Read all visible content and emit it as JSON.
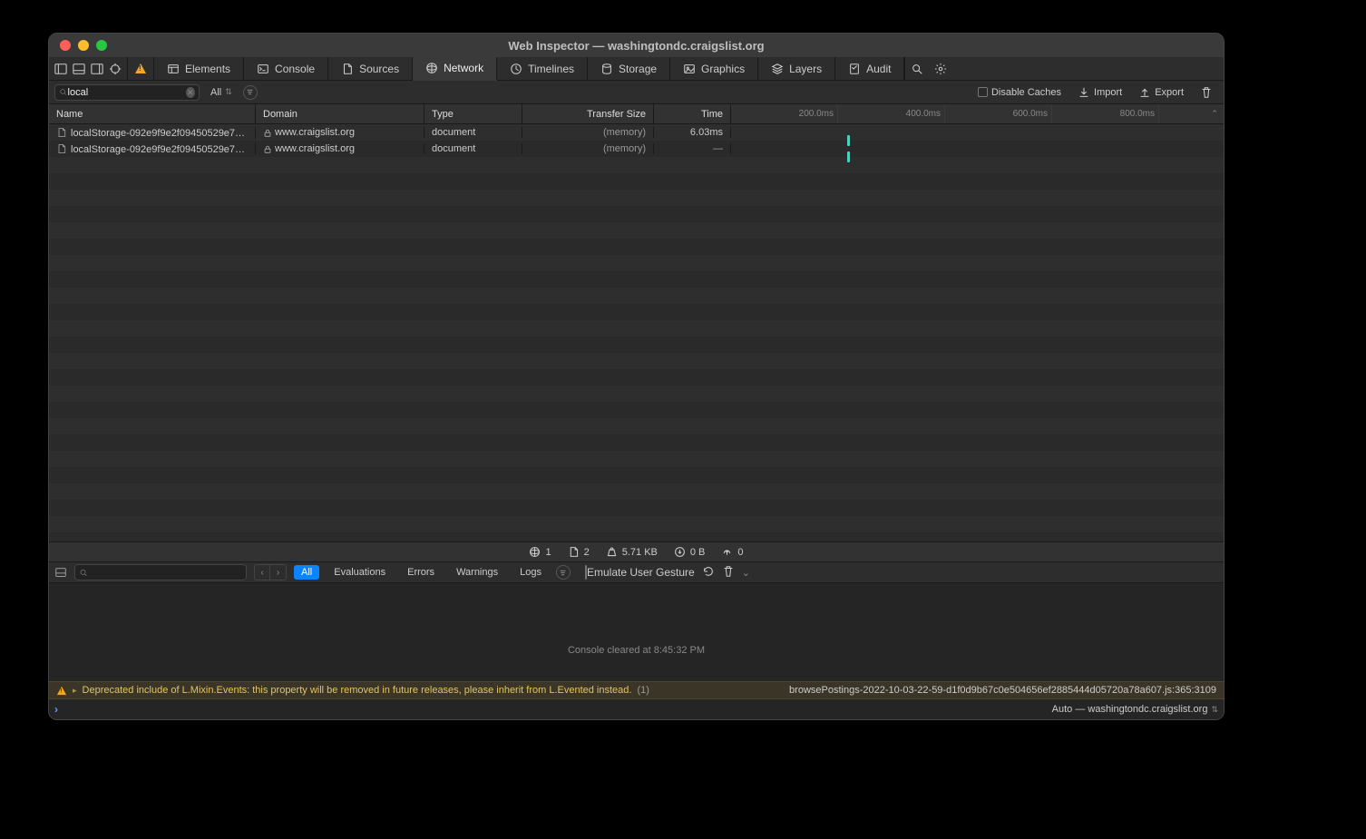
{
  "title": "Web Inspector — washingtondc.craigslist.org",
  "tabs": {
    "elements": "Elements",
    "console": "Console",
    "sources": "Sources",
    "network": "Network",
    "timelines": "Timelines",
    "storage": "Storage",
    "graphics": "Graphics",
    "layers": "Layers",
    "audit": "Audit"
  },
  "filter": {
    "value": "local",
    "scope": "All"
  },
  "toolbar_right": {
    "disable_caches": "Disable Caches",
    "import": "Import",
    "export": "Export"
  },
  "columns": {
    "name": "Name",
    "domain": "Domain",
    "type": "Type",
    "size": "Transfer Size",
    "time": "Time"
  },
  "ticks": [
    "200.0ms",
    "400.0ms",
    "600.0ms",
    "800.0ms"
  ],
  "rows": [
    {
      "name": "localStorage-092e9f9e2f09450529e74…",
      "domain": "www.craigslist.org",
      "type": "document",
      "size": "(memory)",
      "time": "6.03ms",
      "barLeft": 128
    },
    {
      "name": "localStorage-092e9f9e2f09450529e74…",
      "domain": "www.craigslist.org",
      "type": "document",
      "size": "(memory)",
      "time": "—",
      "barLeft": 128
    }
  ],
  "footer": {
    "requests": "1",
    "docs": "2",
    "transferred": "5.71 KB",
    "loaded": "0 B",
    "other": "0"
  },
  "console": {
    "tabs": {
      "all": "All",
      "eval": "Evaluations",
      "errors": "Errors",
      "warnings": "Warnings",
      "logs": "Logs"
    },
    "emulate": "Emulate User Gesture",
    "cleared": "Console cleared at 8:45:32 PM",
    "warn_msg": "Deprecated include of L.Mixin.Events: this property will be removed in future releases, please inherit from L.Evented instead.",
    "warn_count": "(1)",
    "warn_src": "browsePostings-2022-10-03-22-59-d1f0d9b67c0e504656ef2885444d05720a78a607.js:365:3109",
    "context": "Auto — washingtondc.craigslist.org"
  }
}
